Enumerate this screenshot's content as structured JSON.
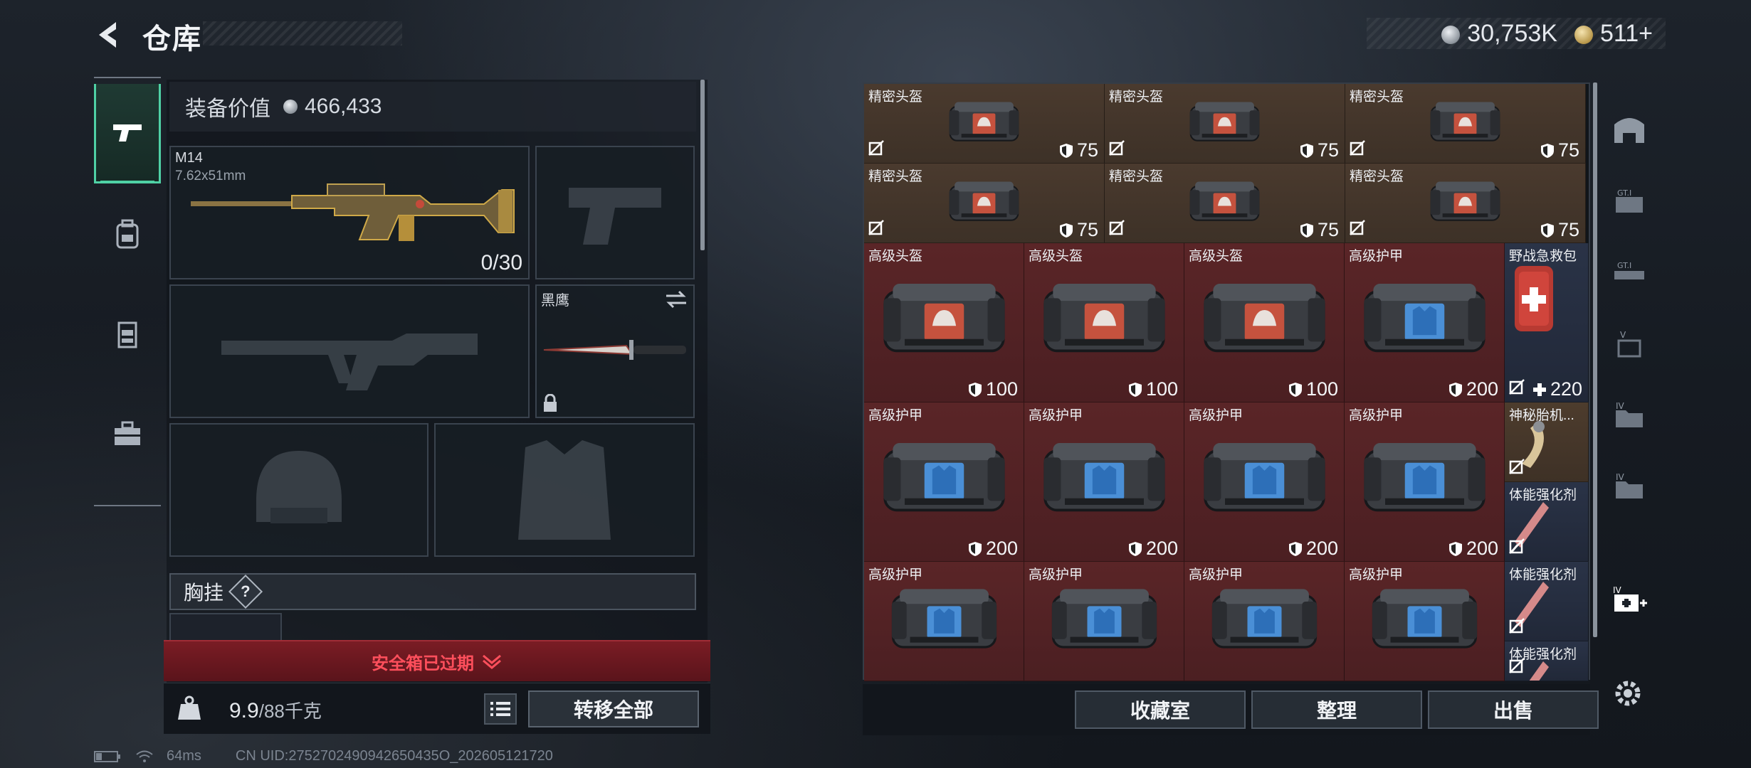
{
  "header": {
    "title": "仓库",
    "back_label": ""
  },
  "currency": {
    "silver": "30,753K",
    "gold": "511+"
  },
  "categories": [
    "gun",
    "backpack",
    "armor-vest",
    "toolbox"
  ],
  "equipment": {
    "value_label": "装备价值",
    "value": "466,433",
    "primary_weapon": {
      "name": "M14",
      "caliber": "7.62x51mm",
      "ammo": "0/30"
    },
    "melee": {
      "name": "黑鹰"
    },
    "chest_rig_label": "胸挂",
    "chest_rig_help": "?"
  },
  "safebox": {
    "text": "安全箱已过期"
  },
  "footer_left": {
    "weight": "9.9",
    "weight_max": "/88千克",
    "transfer_all": "转移全部"
  },
  "inventory": {
    "rows": [
      [
        {
          "name": "精密头盔",
          "value": "75",
          "kind": "helmet",
          "bg": "brown"
        },
        {
          "name": "精密头盔",
          "value": "75",
          "kind": "helmet",
          "bg": "brown"
        },
        {
          "name": "精密头盔",
          "value": "75",
          "kind": "helmet",
          "bg": "brown"
        }
      ],
      [
        {
          "name": "精密头盔",
          "value": "75",
          "kind": "helmet",
          "bg": "brown"
        },
        {
          "name": "精密头盔",
          "value": "75",
          "kind": "helmet",
          "bg": "brown"
        },
        {
          "name": "精密头盔",
          "value": "75",
          "kind": "helmet",
          "bg": "brown"
        }
      ],
      [
        {
          "name": "高级头盔",
          "value": "100",
          "kind": "helmet",
          "bg": "red"
        },
        {
          "name": "高级头盔",
          "value": "100",
          "kind": "helmet",
          "bg": "red"
        },
        {
          "name": "高级头盔",
          "value": "100",
          "kind": "helmet",
          "bg": "red"
        },
        {
          "name": "高级护甲",
          "value": "200",
          "kind": "armor",
          "bg": "red"
        }
      ],
      [
        {
          "name": "高级护甲",
          "value": "200",
          "kind": "armor",
          "bg": "red"
        },
        {
          "name": "高级护甲",
          "value": "200",
          "kind": "armor",
          "bg": "red"
        },
        {
          "name": "高级护甲",
          "value": "200",
          "kind": "armor",
          "bg": "red"
        },
        {
          "name": "高级护甲",
          "value": "200",
          "kind": "armor",
          "bg": "red"
        }
      ],
      [
        {
          "name": "高级护甲",
          "value": "",
          "kind": "armor",
          "bg": "red"
        },
        {
          "name": "高级护甲",
          "value": "",
          "kind": "armor",
          "bg": "red"
        },
        {
          "name": "高级护甲",
          "value": "",
          "kind": "armor",
          "bg": "red"
        },
        {
          "name": "高级护甲",
          "value": "",
          "kind": "armor",
          "bg": "red"
        }
      ]
    ],
    "side_items": [
      {
        "name": "野战急救包",
        "value": "220",
        "kind": "medkit",
        "bg": "navy"
      },
      {
        "name": "神秘胎机...",
        "value": "",
        "kind": "horn",
        "bg": "tan"
      },
      {
        "name": "体能强化剂",
        "value": "",
        "kind": "injector",
        "bg": "navy"
      },
      {
        "name": "体能强化剂",
        "value": "",
        "kind": "injector",
        "bg": "navy"
      },
      {
        "name": "体能强化剂",
        "value": "",
        "kind": "injector",
        "bg": "navy"
      }
    ]
  },
  "grid_buttons": [
    "收藏室",
    "整理",
    "出售"
  ],
  "status": {
    "ping": "64ms",
    "uid": "CN UID:2752702490942650435O_202605121720"
  },
  "colors": {
    "accent": "#4fd1a5",
    "danger": "#ff4f5c",
    "brown_cell": "#4a3a2e",
    "red_cell": "#5a2527"
  }
}
